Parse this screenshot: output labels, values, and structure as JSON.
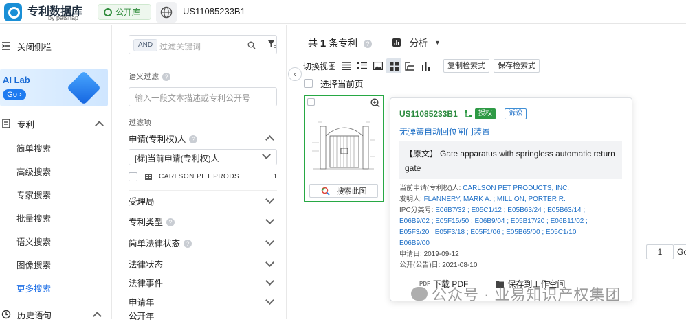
{
  "header": {
    "app_title": "专利数据库",
    "app_subtitle": "by patsnap",
    "library_label": "公开库",
    "search_value": "US11085233B1"
  },
  "sidebar": {
    "close_label": "关闭侧栏",
    "ailab_title": "AI Lab",
    "ailab_go": "Go",
    "patent_group": "专利",
    "items": [
      {
        "label": "简单搜索"
      },
      {
        "label": "高级搜索"
      },
      {
        "label": "专家搜索"
      },
      {
        "label": "批量搜索"
      },
      {
        "label": "语义搜索"
      },
      {
        "label": "图像搜索"
      },
      {
        "label": "更多搜索"
      }
    ],
    "history_label": "历史语句"
  },
  "filters": {
    "and_tag": "AND",
    "keyword_placeholder": "过滤关键词",
    "semantic_label": "语义过滤",
    "semantic_placeholder": "输入一段文本描述或专利公开号",
    "filter_items_label": "过滤项",
    "applicant_section": "申请(专利权)人",
    "applicant_select": "[标]当前申请(专利权)人",
    "applicant_option": "CARLSON PET PRODS",
    "applicant_count": "1",
    "sections": [
      "受理局",
      "专利类型",
      "简单法律状态",
      "法律状态",
      "法律事件",
      "申请年",
      "公开年"
    ]
  },
  "results": {
    "count_prefix": "共",
    "count_value": "1",
    "count_suffix": "条专利",
    "analyze_label": "分析",
    "switch_view_label": "切换视图",
    "copy_query_label": "复制检索式",
    "save_query_label": "保存检索式",
    "select_page_label": "选择当前页",
    "image_search_label": "搜索此图",
    "page_number": "1",
    "go_label": "Go"
  },
  "popup": {
    "pn": "US11085233B1",
    "status_tag": "授权",
    "lit_tag": "诉讼",
    "title_cn": "无弹簧自动回位闸门装置",
    "orig_prefix": "【原文】",
    "orig_title": "Gate apparatus with springless automatic return gate",
    "assignee_label": "当前申请(专利权)人:",
    "assignee": "CARLSON PET PRODUCTS, INC.",
    "inventor_label": "发明人:",
    "inventors": "FLANNERY, MARK A. ;  MILLION, PORTER R.",
    "ipc_label": "IPC分类号:",
    "ipc_line1": "E06B7/32 ;  E05C1/12 ;  E05B63/24 ;  E05B63/14 ;",
    "ipc_line2": "E06B9/02 ;  E05F15/50 ;  E06B9/04 ;  E05B17/20 ;  E06B11/02 ;",
    "ipc_line3": "E05F3/20 ;  E05F3/18 ;  E05F1/06 ;  E05B65/00 ;  E05C1/10 ;",
    "ipc_line4": "E06B9/00",
    "app_date_label": "申请日:",
    "app_date": "2019-09-12",
    "pub_date_label": "公开(公告)日:",
    "pub_date": "2021-08-10",
    "download_pdf": "下载 PDF",
    "save_workspace": "保存到工作空间",
    "pdf_icon_text": "PDF"
  },
  "watermark": "公众号 · 业易知识产权集团",
  "colors": {
    "accent_blue": "#1e6fc6",
    "grant_green": "#2e9a45",
    "selection_green": "#27a844"
  }
}
